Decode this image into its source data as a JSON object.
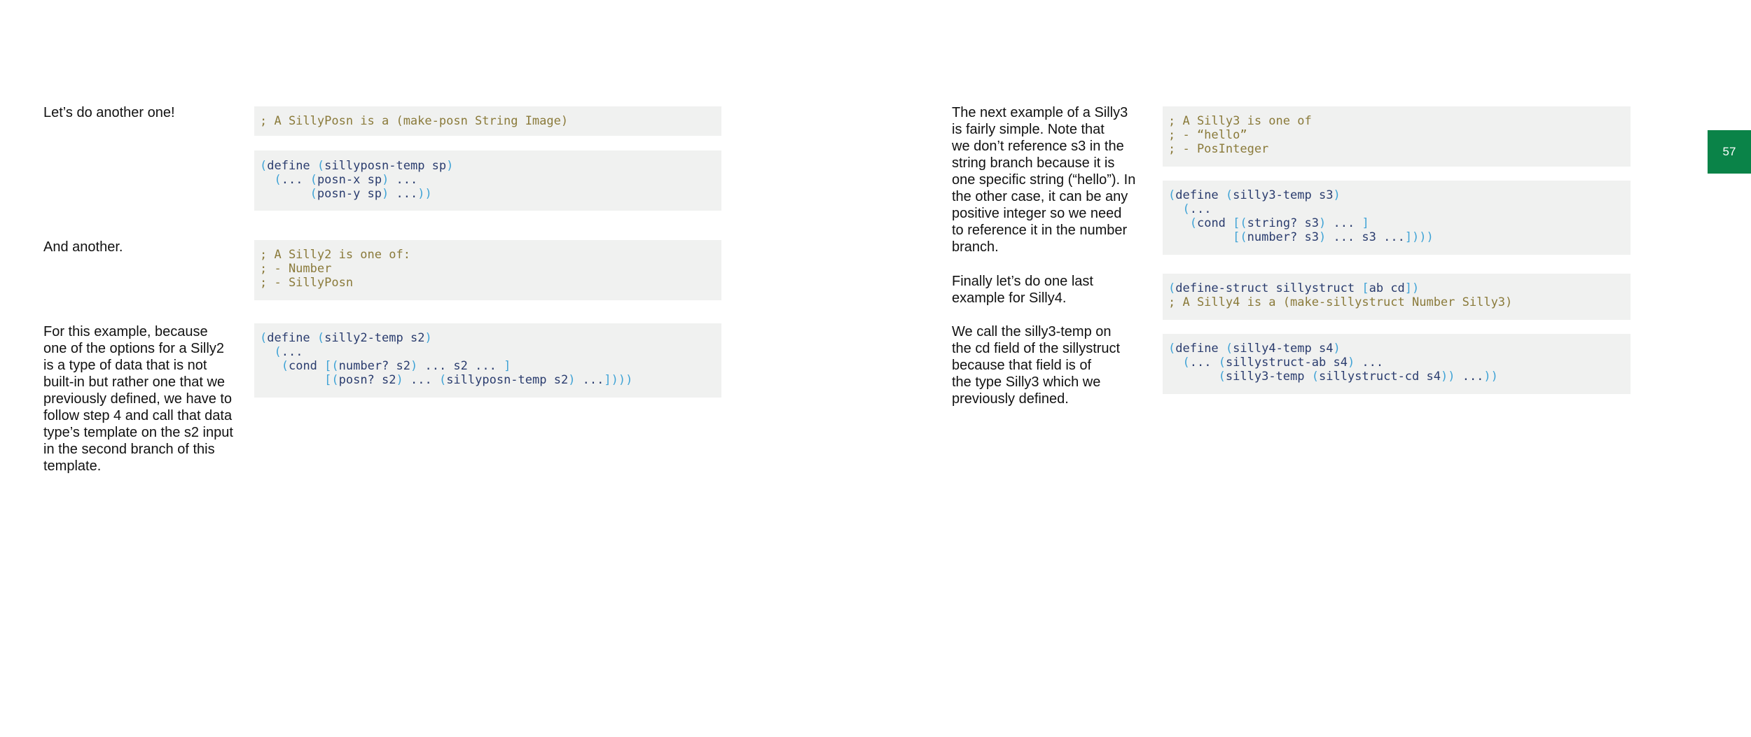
{
  "page_number": "57",
  "left": {
    "p1": [
      "Let’s do another one!"
    ],
    "code1": [
      [
        {
          "t": "; A SillyPosn is a (make-posn String Image)",
          "c": "cm"
        }
      ]
    ],
    "code2": [
      [
        {
          "t": "(",
          "c": "br"
        },
        {
          "t": "define ",
          "c": "kw"
        },
        {
          "t": "(",
          "c": "br"
        },
        {
          "t": "sillyposn-temp sp",
          "c": "kw"
        },
        {
          "t": ")",
          "c": "br"
        }
      ],
      [
        {
          "t": "  ",
          "c": "kw"
        },
        {
          "t": "(",
          "c": "br"
        },
        {
          "t": "... ",
          "c": "kw"
        },
        {
          "t": "(",
          "c": "br"
        },
        {
          "t": "posn-x sp",
          "c": "kw"
        },
        {
          "t": ")",
          "c": "br"
        },
        {
          "t": " ...",
          "c": "kw"
        }
      ],
      [
        {
          "t": "       ",
          "c": "kw"
        },
        {
          "t": "(",
          "c": "br"
        },
        {
          "t": "posn-y sp",
          "c": "kw"
        },
        {
          "t": ")",
          "c": "br"
        },
        {
          "t": " ...",
          "c": "kw"
        },
        {
          "t": "))",
          "c": "br"
        }
      ]
    ],
    "p2": [
      "And another."
    ],
    "code3": [
      [
        {
          "t": "; A Silly2 is one of:",
          "c": "cm"
        }
      ],
      [
        {
          "t": "; - Number",
          "c": "cm"
        }
      ],
      [
        {
          "t": "; - SillyPosn",
          "c": "cm"
        }
      ]
    ],
    "p3": [
      "For this example, because",
      "one of the options for a Silly2",
      "is a type of data that is not",
      "built-in but rather one that we",
      "previously defined, we have to",
      "follow step 4 and call that data",
      "type’s template on the s2 input",
      "in the second branch of this",
      "template."
    ],
    "code4": [
      [
        {
          "t": "(",
          "c": "br"
        },
        {
          "t": "define ",
          "c": "kw"
        },
        {
          "t": "(",
          "c": "br"
        },
        {
          "t": "silly2-temp s2",
          "c": "kw"
        },
        {
          "t": ")",
          "c": "br"
        }
      ],
      [
        {
          "t": "  ",
          "c": "kw"
        },
        {
          "t": "(",
          "c": "br"
        },
        {
          "t": "...",
          "c": "kw"
        }
      ],
      [
        {
          "t": "   ",
          "c": "kw"
        },
        {
          "t": "(",
          "c": "br"
        },
        {
          "t": "cond ",
          "c": "kw"
        },
        {
          "t": "[(",
          "c": "br"
        },
        {
          "t": "number? s2",
          "c": "kw"
        },
        {
          "t": ")",
          "c": "br"
        },
        {
          "t": " ... s2 ... ",
          "c": "kw"
        },
        {
          "t": "]",
          "c": "br"
        }
      ],
      [
        {
          "t": "         ",
          "c": "kw"
        },
        {
          "t": "[(",
          "c": "br"
        },
        {
          "t": "posn? s2",
          "c": "kw"
        },
        {
          "t": ")",
          "c": "br"
        },
        {
          "t": " ... ",
          "c": "kw"
        },
        {
          "t": "(",
          "c": "br"
        },
        {
          "t": "sillyposn-temp s2",
          "c": "kw"
        },
        {
          "t": ")",
          "c": "br"
        },
        {
          "t": " ...",
          "c": "kw"
        },
        {
          "t": "])))",
          "c": "br"
        }
      ]
    ]
  },
  "right": {
    "p1": [
      "The next example of a Silly3",
      "is fairly simple. Note that",
      "we don’t reference s3 in the",
      "string branch because it is",
      "one specific string (“hello”). In",
      "the other case, it can be any",
      "positive integer so we need",
      "to reference it in the number",
      "branch."
    ],
    "code1": [
      [
        {
          "t": "; A Silly3 is one of",
          "c": "cm"
        }
      ],
      [
        {
          "t": "; - “hello”",
          "c": "cm"
        }
      ],
      [
        {
          "t": "; - PosInteger",
          "c": "cm"
        }
      ]
    ],
    "code2": [
      [
        {
          "t": "(",
          "c": "br"
        },
        {
          "t": "define ",
          "c": "kw"
        },
        {
          "t": "(",
          "c": "br"
        },
        {
          "t": "silly3-temp s3",
          "c": "kw"
        },
        {
          "t": ")",
          "c": "br"
        }
      ],
      [
        {
          "t": "  ",
          "c": "kw"
        },
        {
          "t": "(",
          "c": "br"
        },
        {
          "t": "...",
          "c": "kw"
        }
      ],
      [
        {
          "t": "   ",
          "c": "kw"
        },
        {
          "t": "(",
          "c": "br"
        },
        {
          "t": "cond ",
          "c": "kw"
        },
        {
          "t": "[(",
          "c": "br"
        },
        {
          "t": "string? s3",
          "c": "kw"
        },
        {
          "t": ")",
          "c": "br"
        },
        {
          "t": " ... ",
          "c": "kw"
        },
        {
          "t": "]",
          "c": "br"
        }
      ],
      [
        {
          "t": "         ",
          "c": "kw"
        },
        {
          "t": "[(",
          "c": "br"
        },
        {
          "t": "number? s3",
          "c": "kw"
        },
        {
          "t": ")",
          "c": "br"
        },
        {
          "t": " ... s3 ...",
          "c": "kw"
        },
        {
          "t": "])))",
          "c": "br"
        }
      ]
    ],
    "p2": [
      "Finally let’s do one last",
      "example for Silly4."
    ],
    "code3": [
      [
        {
          "t": "(",
          "c": "br"
        },
        {
          "t": "define-struct sillystruct ",
          "c": "kw"
        },
        {
          "t": "[",
          "c": "br"
        },
        {
          "t": "ab cd",
          "c": "kw"
        },
        {
          "t": "])",
          "c": "br"
        }
      ],
      [
        {
          "t": "; A Silly4 is a (make-sillystruct Number Silly3)",
          "c": "cm"
        }
      ]
    ],
    "p3": [
      "We call the silly3-temp on",
      "the cd field of the sillystruct",
      "because that field is of",
      "the type Silly3 which we",
      "previously defined."
    ],
    "code4": [
      [
        {
          "t": "(",
          "c": "br"
        },
        {
          "t": "define ",
          "c": "kw"
        },
        {
          "t": "(",
          "c": "br"
        },
        {
          "t": "silly4-temp s4",
          "c": "kw"
        },
        {
          "t": ")",
          "c": "br"
        }
      ],
      [
        {
          "t": "  ",
          "c": "kw"
        },
        {
          "t": "(",
          "c": "br"
        },
        {
          "t": "... ",
          "c": "kw"
        },
        {
          "t": "(",
          "c": "br"
        },
        {
          "t": "sillystruct-ab s4",
          "c": "kw"
        },
        {
          "t": ")",
          "c": "br"
        },
        {
          "t": " ...",
          "c": "kw"
        }
      ],
      [
        {
          "t": "       ",
          "c": "kw"
        },
        {
          "t": "(",
          "c": "br"
        },
        {
          "t": "silly3-temp ",
          "c": "kw"
        },
        {
          "t": "(",
          "c": "br"
        },
        {
          "t": "sillystruct-cd s4",
          "c": "kw"
        },
        {
          "t": "))",
          "c": "br"
        },
        {
          "t": " ...",
          "c": "kw"
        },
        {
          "t": "))",
          "c": "br"
        }
      ]
    ]
  }
}
